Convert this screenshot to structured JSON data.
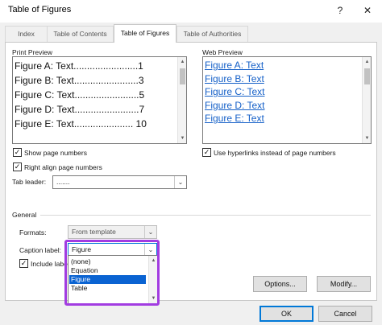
{
  "window": {
    "title": "Table of Figures",
    "help_glyph": "?",
    "close_glyph": "✕"
  },
  "tabs": [
    {
      "label": "Index"
    },
    {
      "label": "Table of Contents"
    },
    {
      "label": "Table of Figures",
      "active": true
    },
    {
      "label": "Table of Authorities"
    }
  ],
  "print_preview": {
    "label": "Print Preview",
    "lines": [
      {
        "text": "Figure A: Text",
        "dots": "........................",
        "page": "1"
      },
      {
        "text": "Figure B: Text",
        "dots": "........................",
        "page": "3"
      },
      {
        "text": "Figure C: Text",
        "dots": "........................",
        "page": "5"
      },
      {
        "text": "Figure D: Text",
        "dots": "........................",
        "page": "7"
      },
      {
        "text": "Figure E: Text",
        "dots": "......................",
        "page": "10"
      }
    ]
  },
  "web_preview": {
    "label": "Web Preview",
    "lines": [
      "Figure A: Text",
      "Figure B: Text",
      "Figure C: Text",
      "Figure D: Text",
      "Figure E: Text"
    ]
  },
  "options": {
    "show_page_numbers": {
      "label": "Show page numbers",
      "checked": true
    },
    "right_align": {
      "label": "Right align page numbers",
      "checked": true
    },
    "tab_leader": {
      "label": "Tab leader:",
      "value": "......."
    },
    "use_hyperlinks": {
      "label": "Use hyperlinks instead of page numbers",
      "checked": true
    }
  },
  "general": {
    "label": "General",
    "formats": {
      "label": "Formats:",
      "value": "From template"
    },
    "caption_label": {
      "label": "Caption label:",
      "value": "Figure"
    },
    "include_label": {
      "label": "Include label",
      "checked": true
    },
    "dropdown_options": [
      "(none)",
      "Equation",
      "Figure",
      "Table"
    ],
    "selected_option": "Figure"
  },
  "buttons": {
    "options": "Options...",
    "modify": "Modify...",
    "ok": "OK",
    "cancel": "Cancel"
  },
  "colors": {
    "link": "#1560c8",
    "selection": "#0a63d2",
    "highlight_border": "#a23ce1",
    "default_button_border": "#0078d7"
  }
}
